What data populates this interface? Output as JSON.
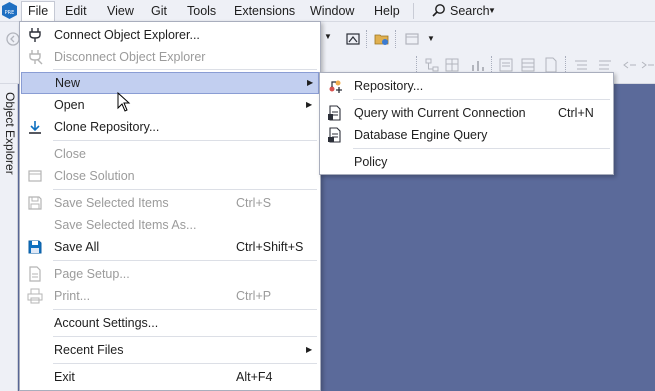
{
  "menubar": {
    "items": [
      {
        "label": "File"
      },
      {
        "label": "Edit"
      },
      {
        "label": "View"
      },
      {
        "label": "Git"
      },
      {
        "label": "Tools"
      },
      {
        "label": "Extensions"
      },
      {
        "label": "Window"
      },
      {
        "label": "Help"
      }
    ],
    "search_label": "Search",
    "app_badge": "PRE"
  },
  "side_tab": {
    "label": "Object Explorer"
  },
  "file_menu": {
    "items": [
      {
        "label": "Connect Object Explorer...",
        "shortcut": "",
        "enabled": true,
        "icon": "plug-connect-icon"
      },
      {
        "label": "Disconnect Object Explorer",
        "shortcut": "",
        "enabled": false,
        "icon": "plug-disconnect-icon"
      },
      {
        "label": "New",
        "shortcut": "",
        "enabled": true,
        "icon": "",
        "submenu": true,
        "highlighted": true
      },
      {
        "label": "Open",
        "shortcut": "",
        "enabled": true,
        "icon": "",
        "submenu": true
      },
      {
        "label": "Clone Repository...",
        "shortcut": "",
        "enabled": true,
        "icon": "download-icon"
      },
      {
        "label": "Close",
        "shortcut": "",
        "enabled": false,
        "icon": ""
      },
      {
        "label": "Close Solution",
        "shortcut": "",
        "enabled": false,
        "icon": "close-solution-icon"
      },
      {
        "label": "Save Selected Items",
        "shortcut": "Ctrl+S",
        "enabled": false,
        "icon": "save-icon"
      },
      {
        "label": "Save Selected Items As...",
        "shortcut": "",
        "enabled": false,
        "icon": ""
      },
      {
        "label": "Save All",
        "shortcut": "Ctrl+Shift+S",
        "enabled": true,
        "icon": "save-all-icon"
      },
      {
        "label": "Page Setup...",
        "shortcut": "",
        "enabled": false,
        "icon": "page-setup-icon"
      },
      {
        "label": "Print...",
        "shortcut": "Ctrl+P",
        "enabled": false,
        "icon": "print-icon"
      },
      {
        "label": "Account Settings...",
        "shortcut": "",
        "enabled": true,
        "icon": ""
      },
      {
        "label": "Recent Files",
        "shortcut": "",
        "enabled": true,
        "icon": "",
        "submenu": true
      },
      {
        "label": "Exit",
        "shortcut": "Alt+F4",
        "enabled": true,
        "icon": ""
      }
    ]
  },
  "new_menu": {
    "items": [
      {
        "label": "Repository...",
        "shortcut": "",
        "icon": "new-repository-icon"
      },
      {
        "label": "Query with Current Connection",
        "shortcut": "Ctrl+N",
        "icon": "query-icon"
      },
      {
        "label": "Database Engine Query",
        "shortcut": "",
        "icon": "database-query-icon"
      },
      {
        "label": "Policy",
        "shortcut": "",
        "icon": ""
      }
    ]
  },
  "colors": {
    "accent": "#0e70c0",
    "highlight": "#c2cff0",
    "workspace": "#5b6a9a"
  }
}
